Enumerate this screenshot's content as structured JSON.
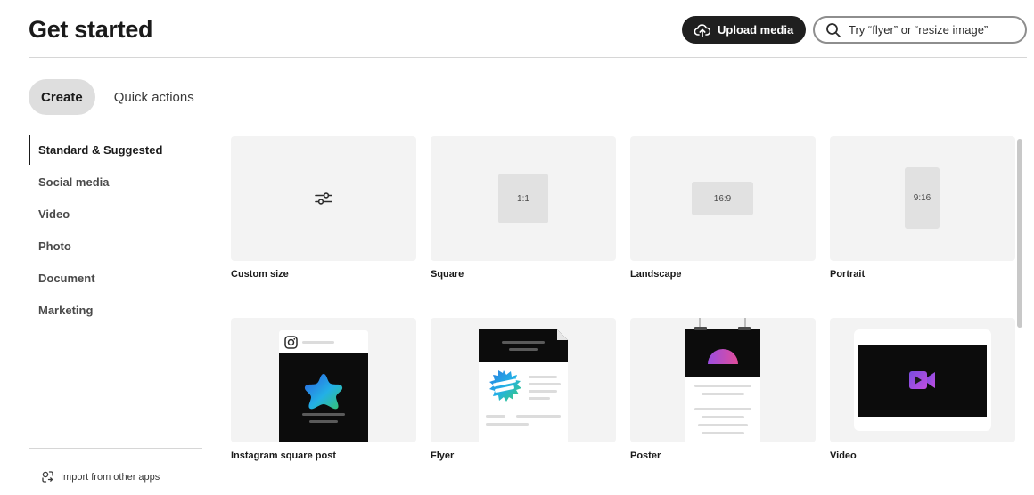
{
  "header": {
    "title": "Get started",
    "upload_label": "Upload media",
    "search_placeholder": "Try “flyer” or “resize image”"
  },
  "tabs": [
    {
      "label": "Create",
      "active": true
    },
    {
      "label": "Quick actions",
      "active": false
    }
  ],
  "sidebar": {
    "items": [
      {
        "label": "Standard & Suggested",
        "active": true
      },
      {
        "label": "Social media"
      },
      {
        "label": "Video"
      },
      {
        "label": "Photo"
      },
      {
        "label": "Document"
      },
      {
        "label": "Marketing"
      }
    ],
    "import_label": "Import from other apps"
  },
  "cards": {
    "custom_size": {
      "label": "Custom size"
    },
    "square": {
      "label": "Square",
      "ratio": "1:1"
    },
    "landscape": {
      "label": "Landscape",
      "ratio": "16:9"
    },
    "portrait": {
      "label": "Portrait",
      "ratio": "9:16"
    },
    "instagram": {
      "label": "Instagram square post"
    },
    "flyer": {
      "label": "Flyer"
    },
    "poster": {
      "label": "Poster"
    },
    "video": {
      "label": "Video"
    }
  },
  "colors": {
    "dark": "#1f1f1f",
    "card_bg": "#f3f3f3",
    "accent_gradient": [
      "#2b5fe0",
      "#23b0e6",
      "#36c46a"
    ],
    "video_icon": "#9b4de0"
  },
  "icons": [
    "upload-icon",
    "search-icon",
    "sliders-icon",
    "instagram-icon",
    "video-camera-icon",
    "import-icon"
  ]
}
